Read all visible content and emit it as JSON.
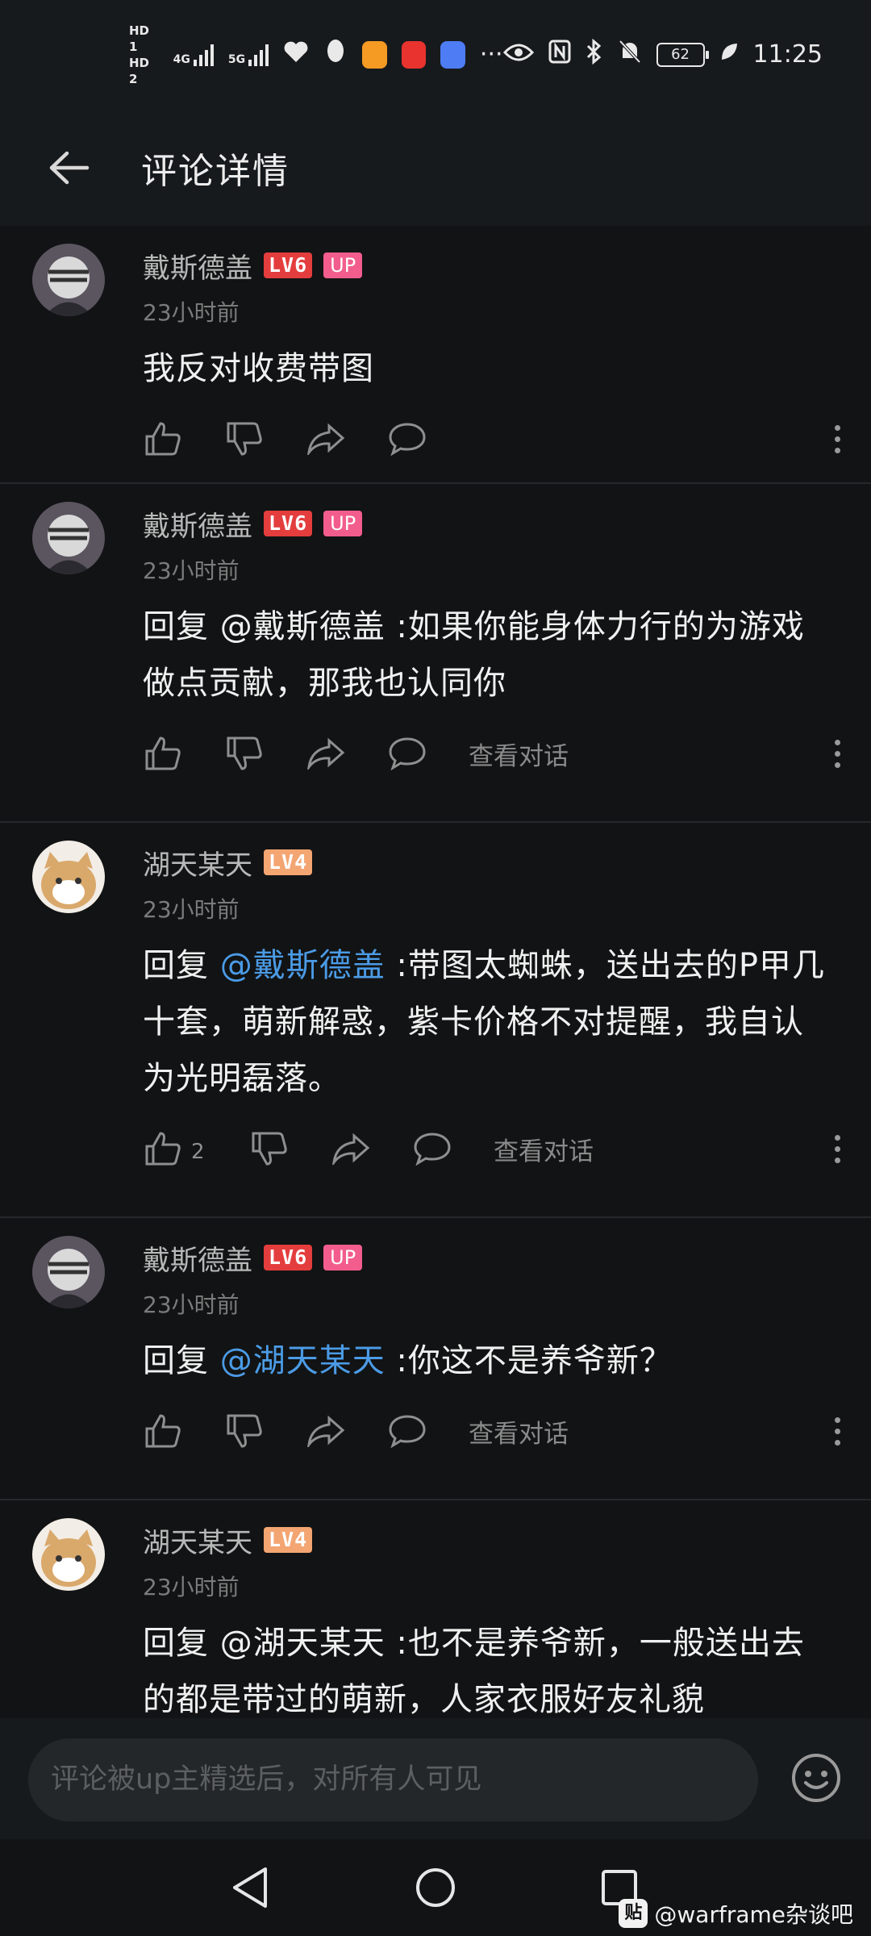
{
  "status_bar": {
    "sim1": "HD 1",
    "sim2": "HD 2",
    "net1": "4G",
    "net2": "5G",
    "more": "···",
    "battery": "62",
    "time": "11:25"
  },
  "header": {
    "title": "评论详情"
  },
  "comments": [
    {
      "name": "戴斯德盖",
      "level": "LV6",
      "badge": "UP",
      "time": "23小时前",
      "text": "我反对收费带图"
    },
    {
      "name": "戴斯德盖",
      "level": "LV6",
      "badge": "UP",
      "time": "23小时前",
      "prefix": "回复 @戴斯德盖 :",
      "text": "如果你能身体力行的为游戏做点贡献，那我也认同你",
      "view_dialog": "查看对话"
    },
    {
      "name": "湖天某天",
      "level": "LV4",
      "time": "23小时前",
      "reply_word": "回复 ",
      "mention": "@戴斯德盖",
      "text": " :带图太蜘蛛，送出去的P甲几十套，萌新解惑，紫卡价格不对提醒，我自认为光明磊落。",
      "likes": "2",
      "view_dialog": "查看对话"
    },
    {
      "name": "戴斯德盖",
      "level": "LV6",
      "badge": "UP",
      "time": "23小时前",
      "reply_word": "回复 ",
      "mention": "@湖天某天",
      "text": " :你这不是养爷新？",
      "view_dialog": "查看对话"
    },
    {
      "name": "湖天某天",
      "level": "LV4",
      "time": "23小时前",
      "text": "回复 @湖天某天 :也不是养爷新，一般送出去的都是带过的萌新，人家衣服好友礼貌"
    }
  ],
  "input": {
    "placeholder": "评论被up主精选后，对所有人可见"
  },
  "watermark": {
    "logo": "贴",
    "text": "@warframe杂谈吧"
  },
  "colors": {
    "background": "#121314",
    "mention": "#4b9be6",
    "lv6": "#e43d3d",
    "lv4": "#f3a572",
    "up_badge": "#f25d8e"
  }
}
